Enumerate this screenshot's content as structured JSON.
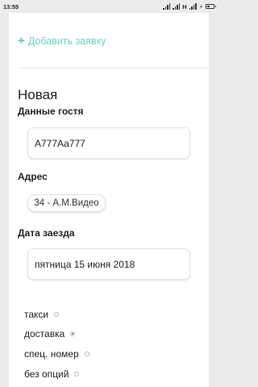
{
  "status_bar": {
    "time": "13:55",
    "network": "H"
  },
  "add_request": {
    "label": "Добавить заявку"
  },
  "page": {
    "title": "Новая"
  },
  "guest": {
    "label": "Данные гостя",
    "value": "А777Аа777"
  },
  "address": {
    "label": "Адрес",
    "selected": "34 - А.М.Видео"
  },
  "arrival": {
    "label": "Дата заезда",
    "value": "пятница 15 июня 2018"
  },
  "options": [
    {
      "label": "такси",
      "selected": false
    },
    {
      "label": "доставка",
      "selected": true
    },
    {
      "label": "спец. номер",
      "selected": false
    },
    {
      "label": "без опций",
      "selected": false
    }
  ],
  "colors": {
    "accent": "#6fd0c6",
    "background": "#eaeaea",
    "card": "#ffffff"
  }
}
